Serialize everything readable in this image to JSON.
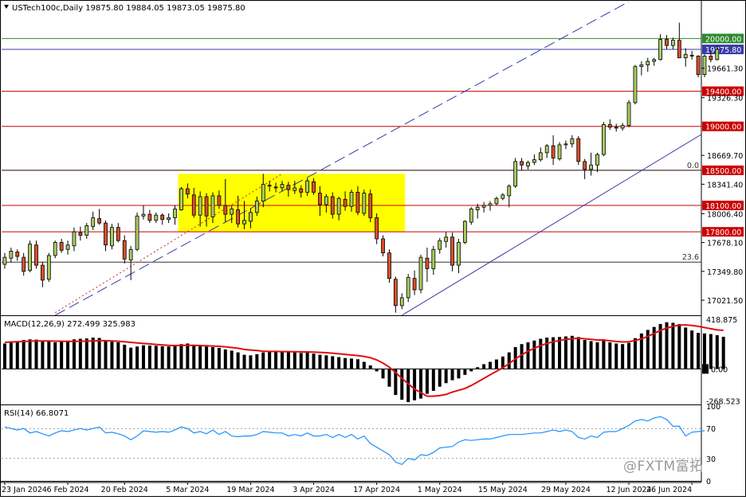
{
  "chart_data": {
    "type": "candlestick",
    "symbol_line": "USTech100c,Daily  19875.80 19884.05 19873.05 19875.80",
    "price_axis": {
      "ylim": [
        16850,
        20420
      ],
      "tick_labels": [
        "20000.00",
        "19875.80",
        "19661.30",
        "19400.00",
        "19326.30",
        "19000.00",
        "18669.70",
        "18500.00",
        "18341.40",
        "18100.00",
        "18006.40",
        "17800.00",
        "17678.10",
        "17349.80",
        "17021.50"
      ]
    },
    "x_axis": {
      "n_bars": 111,
      "tick_labels": [
        {
          "bar": 0,
          "label": "23 Jan 2024"
        },
        {
          "bar": 10,
          "label": "6 Feb 2024"
        },
        {
          "bar": 19,
          "label": "20 Feb 2024"
        },
        {
          "bar": 29,
          "label": "5 Mar 2024"
        },
        {
          "bar": 39,
          "label": "19 Mar 2024"
        },
        {
          "bar": 49,
          "label": "3 Apr 2024"
        },
        {
          "bar": 59,
          "label": "17 Apr 2024"
        },
        {
          "bar": 69,
          "label": "1 May 2024"
        },
        {
          "bar": 79,
          "label": "15 May 2024"
        },
        {
          "bar": 89,
          "label": "29 May 2024"
        },
        {
          "bar": 99,
          "label": "12 Jun 2024"
        },
        {
          "bar": 109,
          "label": "26 Jun 2024"
        }
      ]
    },
    "ohlc": [
      [
        17430,
        17560,
        17380,
        17510
      ],
      [
        17500,
        17620,
        17450,
        17580
      ],
      [
        17570,
        17600,
        17470,
        17520
      ],
      [
        17510,
        17560,
        17300,
        17350
      ],
      [
        17360,
        17700,
        17340,
        17660
      ],
      [
        17650,
        17700,
        17380,
        17420
      ],
      [
        17420,
        17460,
        17170,
        17250
      ],
      [
        17260,
        17560,
        17230,
        17530
      ],
      [
        17530,
        17700,
        17500,
        17680
      ],
      [
        17680,
        17720,
        17560,
        17590
      ],
      [
        17600,
        17700,
        17540,
        17650
      ],
      [
        17640,
        17850,
        17580,
        17800
      ],
      [
        17790,
        17860,
        17700,
        17760
      ],
      [
        17760,
        17900,
        17720,
        17870
      ],
      [
        17860,
        18030,
        17820,
        17960
      ],
      [
        17950,
        18060,
        17880,
        17900
      ],
      [
        17900,
        17930,
        17580,
        17650
      ],
      [
        17640,
        17890,
        17600,
        17850
      ],
      [
        17850,
        17900,
        17680,
        17700
      ],
      [
        17700,
        17760,
        17440,
        17490
      ],
      [
        17480,
        17640,
        17250,
        17600
      ],
      [
        17600,
        18020,
        17580,
        17980
      ],
      [
        17980,
        18100,
        17940,
        18000
      ],
      [
        18000,
        18050,
        17900,
        17930
      ],
      [
        17930,
        18020,
        17900,
        17990
      ],
      [
        17990,
        18010,
        17880,
        17940
      ],
      [
        17940,
        18010,
        17900,
        17960
      ],
      [
        17960,
        18100,
        17880,
        18060
      ],
      [
        18050,
        18310,
        18040,
        18290
      ],
      [
        18290,
        18350,
        18180,
        18230
      ],
      [
        18220,
        18300,
        17960,
        17990
      ],
      [
        17990,
        18260,
        17860,
        18200
      ],
      [
        18200,
        18240,
        17860,
        17980
      ],
      [
        17970,
        18250,
        17900,
        18210
      ],
      [
        18210,
        18270,
        18060,
        18100
      ],
      [
        18100,
        18400,
        17910,
        18000
      ],
      [
        18000,
        18100,
        17900,
        18060
      ],
      [
        18050,
        18210,
        17850,
        17890
      ],
      [
        17890,
        18150,
        17830,
        17930
      ],
      [
        17920,
        18070,
        17840,
        18020
      ],
      [
        18020,
        18200,
        17980,
        18150
      ],
      [
        18150,
        18460,
        18080,
        18340
      ],
      [
        18330,
        18380,
        18260,
        18320
      ],
      [
        18310,
        18360,
        18250,
        18300
      ],
      [
        18300,
        18380,
        18260,
        18340
      ],
      [
        18330,
        18370,
        18200,
        18280
      ],
      [
        18270,
        18380,
        18230,
        18300
      ],
      [
        18290,
        18330,
        18190,
        18250
      ],
      [
        18250,
        18410,
        18210,
        18380
      ],
      [
        18370,
        18410,
        18220,
        18250
      ],
      [
        18240,
        18320,
        17980,
        18110
      ],
      [
        18110,
        18230,
        18020,
        18200
      ],
      [
        18200,
        18250,
        17950,
        18000
      ],
      [
        18000,
        18200,
        17930,
        18180
      ],
      [
        18170,
        18260,
        18040,
        18090
      ],
      [
        18090,
        18280,
        18030,
        18250
      ],
      [
        18250,
        18320,
        17990,
        18020
      ],
      [
        18010,
        18280,
        17980,
        18240
      ],
      [
        18230,
        18280,
        17910,
        17960
      ],
      [
        17960,
        18010,
        17660,
        17720
      ],
      [
        17720,
        17760,
        17520,
        17560
      ],
      [
        17560,
        17600,
        17220,
        17270
      ],
      [
        17260,
        17290,
        16880,
        16960
      ],
      [
        16960,
        17100,
        16920,
        17050
      ],
      [
        17050,
        17320,
        17000,
        17280
      ],
      [
        17270,
        17360,
        17080,
        17140
      ],
      [
        17140,
        17540,
        17100,
        17510
      ],
      [
        17500,
        17620,
        17230,
        17380
      ],
      [
        17380,
        17640,
        17310,
        17600
      ],
      [
        17600,
        17730,
        17550,
        17700
      ],
      [
        17690,
        17800,
        17620,
        17740
      ],
      [
        17740,
        17790,
        17350,
        17420
      ],
      [
        17420,
        17720,
        17330,
        17680
      ],
      [
        17680,
        17930,
        17660,
        17920
      ],
      [
        17910,
        18080,
        17880,
        18060
      ],
      [
        18050,
        18120,
        17950,
        18080
      ],
      [
        18080,
        18140,
        18020,
        18100
      ],
      [
        18100,
        18150,
        18040,
        18120
      ],
      [
        18120,
        18200,
        18100,
        18180
      ],
      [
        18180,
        18240,
        18160,
        18220
      ],
      [
        18210,
        18340,
        18080,
        18320
      ],
      [
        18320,
        18640,
        18300,
        18600
      ],
      [
        18600,
        18640,
        18500,
        18560
      ],
      [
        18550,
        18610,
        18510,
        18590
      ],
      [
        18590,
        18680,
        18560,
        18620
      ],
      [
        18620,
        18760,
        18600,
        18700
      ],
      [
        18700,
        18800,
        18640,
        18780
      ],
      [
        18780,
        18900,
        18560,
        18640
      ],
      [
        18630,
        18820,
        18610,
        18790
      ],
      [
        18790,
        18840,
        18740,
        18800
      ],
      [
        18800,
        18900,
        18760,
        18860
      ],
      [
        18860,
        18890,
        18560,
        18600
      ],
      [
        18600,
        18630,
        18400,
        18510
      ],
      [
        18510,
        18700,
        18440,
        18560
      ],
      [
        18560,
        18700,
        18480,
        18680
      ],
      [
        18680,
        19050,
        18660,
        19020
      ],
      [
        19020,
        19080,
        18960,
        18990
      ],
      [
        18990,
        19030,
        18940,
        18980
      ],
      [
        18980,
        19040,
        18950,
        19010
      ],
      [
        19010,
        19300,
        18990,
        19270
      ],
      [
        19270,
        19700,
        19250,
        19680
      ],
      [
        19680,
        19740,
        19580,
        19700
      ],
      [
        19700,
        19780,
        19620,
        19740
      ],
      [
        19740,
        19780,
        19690,
        19760
      ],
      [
        19760,
        20050,
        19750,
        19990
      ],
      [
        19990,
        20040,
        19880,
        19920
      ],
      [
        19920,
        20010,
        19880,
        19980
      ],
      [
        19980,
        20180,
        19810,
        19780
      ],
      [
        19780,
        19890,
        19680,
        19820
      ],
      [
        19810,
        19860,
        19760,
        19800
      ],
      [
        19800,
        19810,
        19560,
        19590
      ],
      [
        19590,
        19820,
        19560,
        19800
      ],
      [
        19800,
        19860,
        19730,
        19760
      ],
      [
        19760,
        19920,
        19750,
        19876
      ]
    ],
    "horizontal_levels": [
      {
        "price": 20000,
        "label": "20000.00",
        "color": "#2e8b2e"
      },
      {
        "price": 19875.8,
        "label": "19875.80",
        "color": "#3a3aa8"
      },
      {
        "price": 19400,
        "label": "19400.00",
        "color": "#cc0000"
      },
      {
        "price": 19000,
        "label": "19000.00",
        "color": "#cc0000"
      },
      {
        "price": 18500,
        "label": "18500.00",
        "color": "#cc0000"
      },
      {
        "price": 18100,
        "label": "18100.00",
        "color": "#cc0000"
      },
      {
        "price": 17800,
        "label": "17800.00",
        "color": "#cc0000"
      }
    ],
    "fib_levels": [
      {
        "price": 18500,
        "label": "0.0"
      },
      {
        "price": 17455,
        "label": "23.6"
      }
    ],
    "rectangle": {
      "bar_start": 28,
      "bar_end": 64,
      "price_top": 18460,
      "price_bottom": 17800,
      "color": "#ffff00"
    },
    "trend_lines": [
      {
        "bar1": 8,
        "price1": 16850,
        "bar2": 99,
        "price2": 20420,
        "color": "#3a3aa8",
        "dash": "dashed"
      },
      {
        "bar1": 8,
        "price1": 16880,
        "bar2": 44,
        "price2": 18460,
        "color": "#cc2222",
        "dash": "dotted"
      },
      {
        "bar1": 63,
        "price1": 16850,
        "bar2": 120,
        "price2": 19320,
        "color": "#3a3aa8",
        "dash": "solid"
      }
    ],
    "macd": {
      "header": "MACD(12,26,9) 272.499 325.983",
      "ylim": [
        -300,
        440
      ],
      "tick_labels": [
        {
          "value": 418.875,
          "label": "418.875"
        },
        {
          "value": 0,
          "label": "0.00"
        },
        {
          "value": -268.523,
          "label": "-268.523"
        }
      ],
      "histogram": [
        215,
        225,
        235,
        245,
        250,
        248,
        240,
        235,
        225,
        230,
        240,
        250,
        255,
        258,
        265,
        262,
        240,
        230,
        225,
        205,
        180,
        190,
        200,
        198,
        196,
        192,
        190,
        195,
        210,
        215,
        205,
        200,
        190,
        185,
        178,
        165,
        155,
        140,
        120,
        115,
        125,
        140,
        148,
        150,
        148,
        145,
        140,
        135,
        138,
        130,
        120,
        115,
        108,
        100,
        92,
        88,
        82,
        60,
        30,
        -20,
        -80,
        -150,
        -220,
        -260,
        -280,
        -265,
        -250,
        -210,
        -185,
        -150,
        -120,
        -95,
        -80,
        -50,
        -20,
        15,
        40,
        60,
        80,
        105,
        140,
        185,
        210,
        225,
        240,
        255,
        265,
        268,
        270,
        275,
        280,
        270,
        245,
        235,
        225,
        240,
        225,
        215,
        210,
        220,
        260,
        300,
        330,
        355,
        380,
        395,
        390,
        380,
        350,
        325,
        305,
        300,
        295,
        285,
        272
      ],
      "signal": [
        225,
        228,
        230,
        232,
        235,
        236,
        236,
        236,
        235,
        234,
        233,
        233,
        234,
        235,
        237,
        239,
        239,
        237,
        234,
        230,
        225,
        220,
        215,
        211,
        207,
        203,
        200,
        198,
        199,
        199,
        199,
        198,
        196,
        194,
        191,
        187,
        181,
        175,
        165,
        160,
        156,
        150,
        148,
        148,
        147,
        147,
        146,
        145,
        144,
        142,
        140,
        137,
        133,
        128,
        123,
        118,
        113,
        106,
        95,
        77,
        50,
        15,
        -30,
        -80,
        -125,
        -170,
        -200,
        -230,
        -230,
        -225,
        -215,
        -195,
        -180,
        -165,
        -140,
        -110,
        -80,
        -50,
        -20,
        10,
        45,
        85,
        120,
        150,
        175,
        198,
        215,
        230,
        240,
        250,
        255,
        260,
        255,
        250,
        245,
        245,
        238,
        232,
        228,
        230,
        240,
        255,
        275,
        300,
        325,
        345,
        360,
        370,
        372,
        368,
        360,
        350,
        340,
        330,
        326
      ]
    },
    "rsi": {
      "header": "RSI(14) 66.8071",
      "ylim": [
        0,
        100
      ],
      "tick_labels": [
        {
          "value": 100,
          "label": "100"
        },
        {
          "value": 70,
          "label": "70"
        },
        {
          "value": 30,
          "label": "30"
        },
        {
          "value": 0,
          "label": "0"
        }
      ],
      "levels": [
        70,
        30
      ],
      "values": [
        72,
        70,
        68,
        70,
        64,
        66,
        63,
        60,
        64,
        67,
        66,
        68,
        70,
        68,
        70,
        72,
        64,
        65,
        63,
        60,
        55,
        60,
        67,
        66,
        65,
        66,
        65,
        68,
        72,
        70,
        64,
        66,
        63,
        68,
        62,
        66,
        60,
        59,
        60,
        60,
        62,
        66,
        65,
        64,
        64,
        60,
        62,
        60,
        64,
        60,
        60,
        62,
        58,
        62,
        58,
        62,
        56,
        60,
        50,
        45,
        40,
        35,
        25,
        22,
        30,
        28,
        35,
        34,
        38,
        44,
        45,
        46,
        52,
        55,
        54,
        55,
        56,
        56,
        58,
        60,
        62,
        62,
        62,
        63,
        64,
        64,
        66,
        68,
        66,
        68,
        66,
        58,
        56,
        60,
        58,
        65,
        66,
        66,
        70,
        74,
        80,
        82,
        80,
        84,
        86,
        82,
        73,
        73,
        60,
        65,
        66,
        67
      ]
    }
  },
  "watermark": "@FXTM富拓"
}
